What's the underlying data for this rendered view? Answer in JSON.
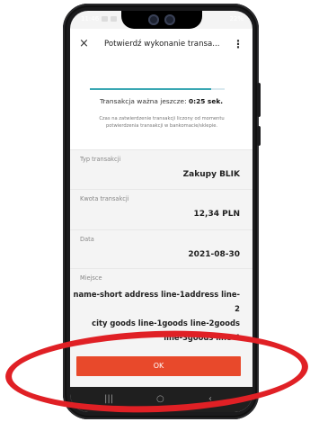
{
  "status_bar": {
    "time": "11:46",
    "right_indicators": "22%"
  },
  "app_bar": {
    "close_glyph": "×",
    "title": "Potwierdź wykonanie transa...",
    "menu_glyph": "⋮"
  },
  "timer": {
    "progress": 0.9,
    "prefix": "Transakcja ważna jeszcze:",
    "remaining": "0:25 sek.",
    "note": "Czas na zatwierdzenie transakcji liczony od momentu potwierdzenia transakcji w bankomacie/sklepie."
  },
  "details": {
    "type_label": "Typ transakcji",
    "type_value": "Zakupy BLIK",
    "amount_label": "Kwota transakcji",
    "amount_value": "12,34 PLN",
    "date_label": "Data",
    "date_value": "2021-08-30",
    "place_label": "Miejsce",
    "place_lines": [
      "name-short address line-1address line-2",
      "city goods line-1goods line-2goods",
      "line-3goods line-4"
    ]
  },
  "ok_button": {
    "label": "OK"
  },
  "nav": {
    "recent": "|||",
    "home": "○",
    "back": "‹"
  },
  "colors": {
    "accent": "#e8492b",
    "progress": "#3aa7b3",
    "highlight_ring": "#e02025"
  }
}
